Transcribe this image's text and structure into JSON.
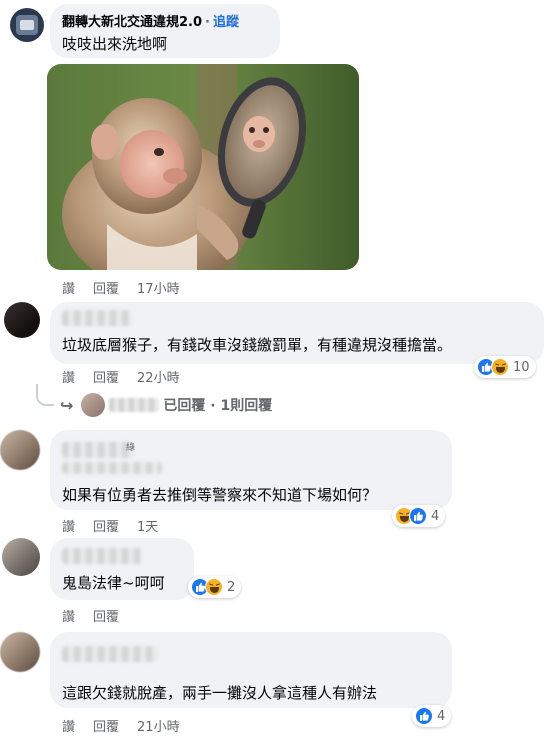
{
  "comments": [
    {
      "author": "翻轉大新北交通違規2.0",
      "follow_sep": "·",
      "follow_label": "追蹤",
      "text": "吱吱出來洗地啊",
      "actions": {
        "like": "讚",
        "reply": "回覆",
        "time": "17小時"
      }
    },
    {
      "text": "垃圾底層猴子，有錢改車沒錢繳罰單，有種違規沒種擔當。",
      "actions": {
        "like": "讚",
        "reply": "回覆",
        "time": "22小時"
      },
      "reactions": {
        "icons": [
          "like-icon",
          "haha-icon"
        ],
        "count": "10"
      },
      "reply_summary": {
        "text": "已回覆 · 1則回覆"
      }
    },
    {
      "name_fragment": "綠",
      "text": "如果有位勇者去推倒等警察來不知道下場如何？",
      "actions": {
        "like": "讚",
        "reply": "回覆",
        "time": "1天"
      },
      "reactions": {
        "icons": [
          "haha-icon",
          "like-icon"
        ],
        "count": "4"
      }
    },
    {
      "text": "鬼島法律~呵呵",
      "actions": {
        "like": "讚",
        "reply": "回覆",
        "time": ""
      },
      "reactions": {
        "icons": [
          "like-icon",
          "haha-icon"
        ],
        "count": "2"
      }
    },
    {
      "text": "這跟欠錢就脫產，兩手一攤沒人拿這種人有辦法",
      "actions": {
        "like": "讚",
        "reply": "回覆",
        "time": "21小時"
      },
      "reactions": {
        "icons": [
          "like-icon"
        ],
        "count": "4"
      }
    }
  ],
  "colors": {
    "bubble": "#f0f2f5",
    "link": "#216fdb",
    "meta": "#65676b",
    "like": "#1877f2",
    "haha": "#f7b125"
  }
}
